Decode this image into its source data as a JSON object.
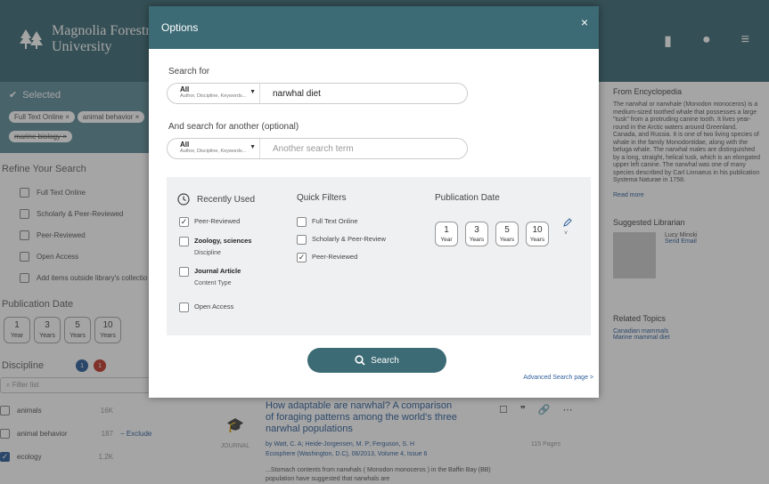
{
  "brand": {
    "name": "Magnolia Forestry S\nUniversity"
  },
  "sidebar": {
    "selected_label": "Selected",
    "chips": [
      "Full Text Online ×",
      "animal behavior ×",
      "marine biology ×"
    ],
    "refine_label": "Refine Your Search",
    "refine_items": [
      "Full Text Online",
      "Scholarly & Peer-Reviewed",
      "Peer-Reviewed",
      "Open Access",
      "Add items outside library's collectio"
    ],
    "pubdate_label": "Publication Date",
    "years": [
      {
        "n": "1",
        "u": "Year"
      },
      {
        "n": "3",
        "u": "Years"
      },
      {
        "n": "5",
        "u": "Years"
      },
      {
        "n": "10",
        "u": "Years"
      }
    ],
    "discipline_label": "Discipline",
    "discipline_badges": [
      "1",
      "1"
    ],
    "filter_placeholder": "Filter list",
    "disciplines": [
      {
        "name": "animals",
        "count": "16K",
        "extra": ""
      },
      {
        "name": "animal behavior",
        "count": "187",
        "extra": "− Exclude"
      },
      {
        "name": "ecology",
        "count": "1.2K",
        "extra": ""
      }
    ]
  },
  "right": {
    "enc_title": "From Encyclopedia",
    "enc_text": "The narwhal or narwhale (Monodon monoceros) is a medium-sized toothed whale that possesses a large \"tusk\" from a protruding canine tooth. It lives year-round in the Arctic waters around Greenland, Canada, and Russia. It is one of two living species of whale in the family Monodontidae, along with the beluga whale. The narwhal males are distinguished by a long, straight, helical tusk, which is an elongated upper left canine. The narwhal was one of many species described by Carl Linnaeus in his publication Systema Naturae in 1758.",
    "read_more": "Read more",
    "lib_title": "Suggested Librarian",
    "lib_name": "Lucy Minski",
    "lib_email": "Send Email",
    "topics_title": "Related Topics",
    "topics": [
      "Canadian mammals",
      "Marine mammal diet"
    ]
  },
  "result": {
    "title": "How adaptable are narwhal? A comparison of foraging patterns among the world's three narwhal populations",
    "authors": "by Watt, C. A; Heide-Jorgensen, M. P; Ferguson, S. H",
    "journal": "Ecosphere (Washington, D.C), 06/2013, Volume 4, Issue 6",
    "pages": "115 Pages",
    "type": "JOURNAL",
    "snippet": "...Stomach contents from narwhals ( Monodon monoceros ) in the Baffin Bay (BB) population have suggested that narwhals are"
  },
  "modal": {
    "title": "Options",
    "close": "×",
    "search_for_label": "Search for",
    "field1": {
      "sel": "All",
      "sub": "Author, Discipline, Keywords...",
      "value": "narwhal diet"
    },
    "another_label": "And search for another  (optional)",
    "field2": {
      "sel": "All",
      "sub": "Author, Discipline, Keywords...",
      "placeholder": "Another search term"
    },
    "recently_used_label": "Recently Used",
    "recent": [
      {
        "label": "Peer-Reviewed",
        "sub": "",
        "checked": true
      },
      {
        "label": "Zoology, sciences",
        "sub": "Discipline",
        "checked": false
      },
      {
        "label": "Journal Article",
        "sub": "Content Type",
        "checked": false
      },
      {
        "label": "Open Access",
        "sub": "",
        "checked": false
      }
    ],
    "quick_filters_label": "Quick Filters",
    "quick": [
      {
        "label": "Full Text Online",
        "checked": false
      },
      {
        "label": "Scholarly & Peer-Review",
        "checked": false
      },
      {
        "label": "Peer-Reviewed",
        "checked": true
      }
    ],
    "pubdate_label": "Publication Date",
    "years": [
      {
        "n": "1",
        "u": "Year"
      },
      {
        "n": "3",
        "u": "Years"
      },
      {
        "n": "5",
        "u": "Years"
      },
      {
        "n": "10",
        "u": "Years"
      }
    ],
    "search_button": "Search",
    "advanced_link": "Advanced Search page >"
  },
  "colors": {
    "header": "#3d6b75",
    "accent": "#2e5f9a"
  }
}
